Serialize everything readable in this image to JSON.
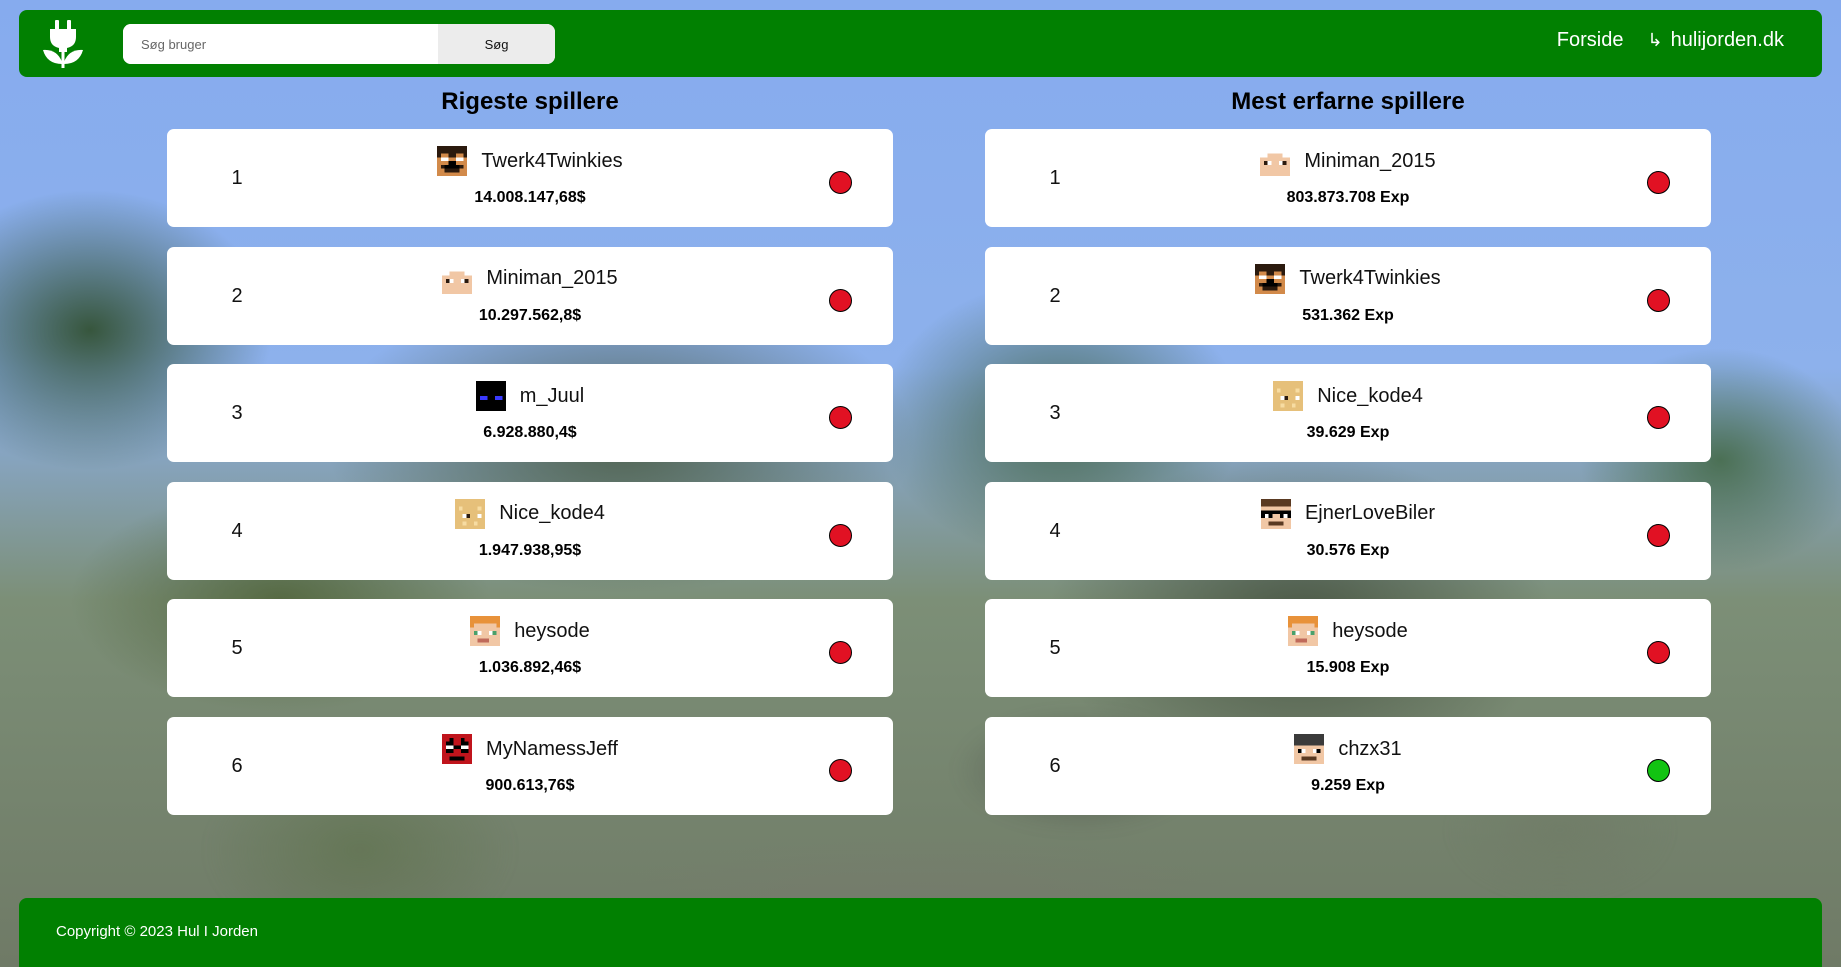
{
  "header": {
    "search": {
      "placeholder": "Søg bruger",
      "button_label": "Søg"
    },
    "nav": {
      "home_label": "Forside",
      "external_arrow": "↳",
      "external_label": "hulijorden.dk"
    }
  },
  "richest": {
    "title": "Rigeste spillere",
    "players": [
      {
        "rank": "1",
        "name": "Twerk4Twinkies",
        "value": "14.008.147,68$",
        "status": "offline"
      },
      {
        "rank": "2",
        "name": "Miniman_2015",
        "value": "10.297.562,8$",
        "status": "offline"
      },
      {
        "rank": "3",
        "name": "m_Juul",
        "value": "6.928.880,4$",
        "status": "offline"
      },
      {
        "rank": "4",
        "name": "Nice_kode4",
        "value": "1.947.938,95$",
        "status": "offline"
      },
      {
        "rank": "5",
        "name": "heysode",
        "value": "1.036.892,46$",
        "status": "offline"
      },
      {
        "rank": "6",
        "name": "MyNamessJeff",
        "value": "900.613,76$",
        "status": "offline"
      }
    ]
  },
  "experienced": {
    "title": "Mest erfarne spillere",
    "players": [
      {
        "rank": "1",
        "name": "Miniman_2015",
        "value": "803.873.708 Exp",
        "status": "offline"
      },
      {
        "rank": "2",
        "name": "Twerk4Twinkies",
        "value": "531.362 Exp",
        "status": "offline"
      },
      {
        "rank": "3",
        "name": "Nice_kode4",
        "value": "39.629 Exp",
        "status": "offline"
      },
      {
        "rank": "4",
        "name": "EjnerLoveBiler",
        "value": "30.576 Exp",
        "status": "offline"
      },
      {
        "rank": "5",
        "name": "heysode",
        "value": "15.908 Exp",
        "status": "offline"
      },
      {
        "rank": "6",
        "name": "chzx31",
        "value": "9.259 Exp",
        "status": "online"
      }
    ]
  },
  "footer": {
    "copyright": "Copyright © 2023 Hul I Jorden"
  },
  "colors": {
    "brand_green": "#018001",
    "status_offline": "#e11123",
    "status_online": "#12c312"
  }
}
